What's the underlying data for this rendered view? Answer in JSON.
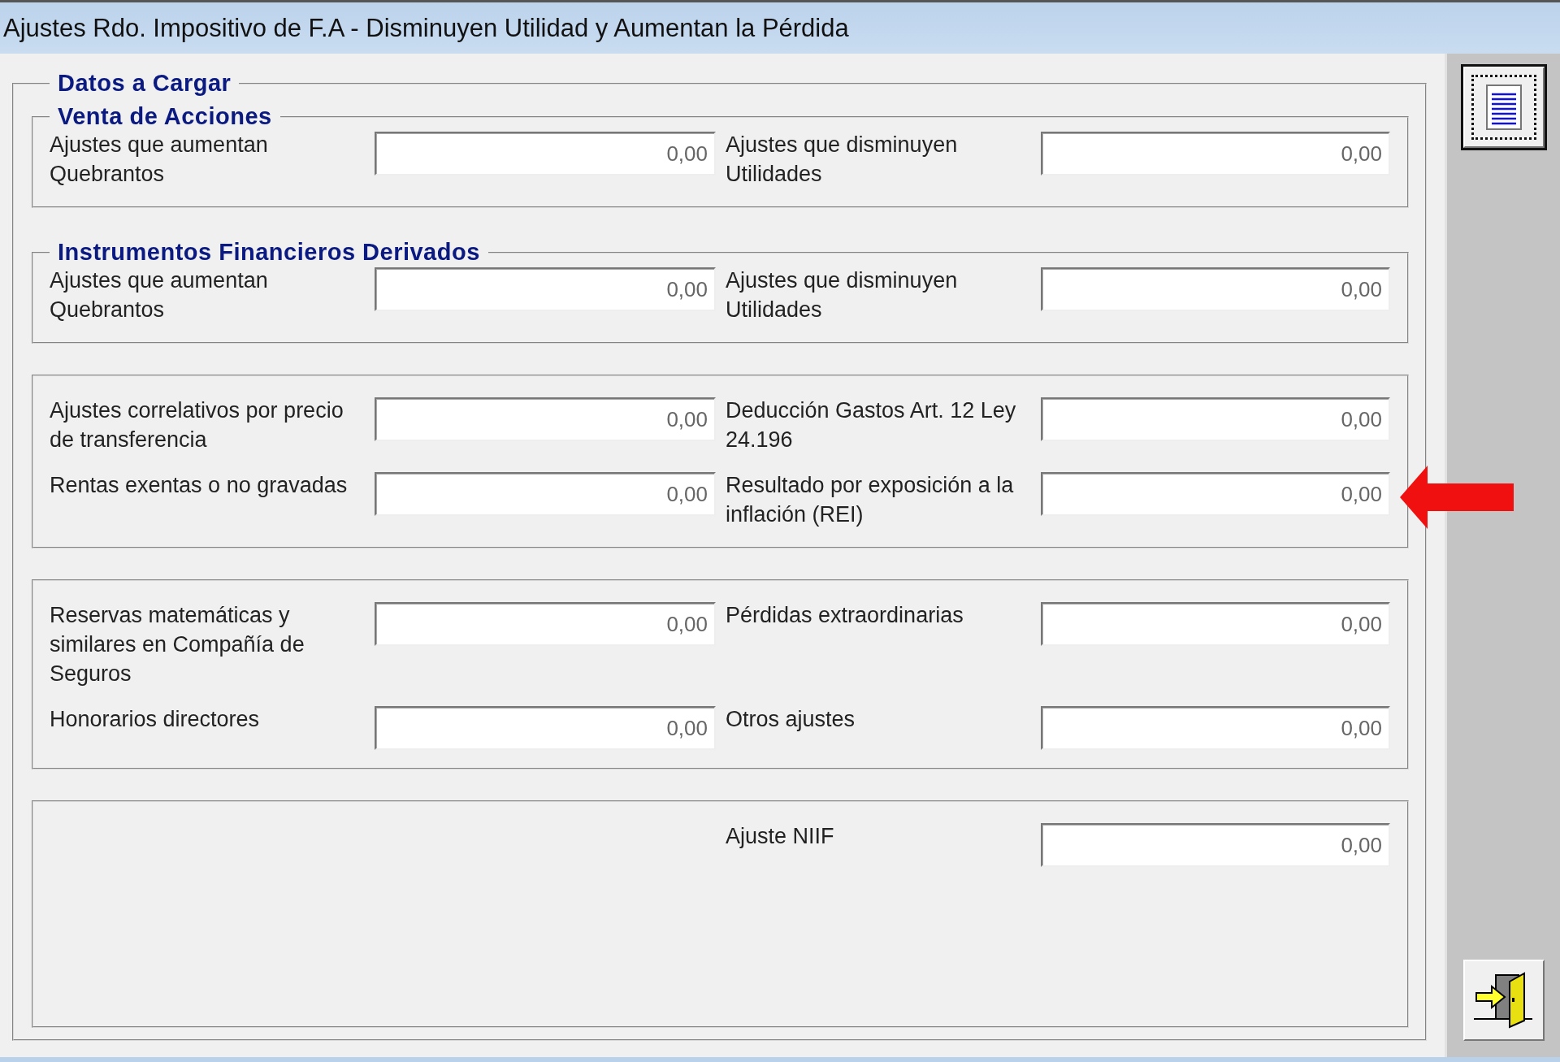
{
  "window": {
    "title": "Ajustes Rdo. Impositivo de F.A - Disminuyen Utilidad y Aumentan la Pérdida"
  },
  "form": {
    "legend": "Datos a Cargar",
    "groups": [
      {
        "legend": "Venta de Acciones",
        "rows": [
          {
            "left": {
              "label": "Ajustes que aumentan Quebrantos",
              "value": "0,00"
            },
            "right": {
              "label": "Ajustes que disminuyen Utilidades",
              "value": "0,00"
            }
          }
        ]
      },
      {
        "legend": "Instrumentos Financieros Derivados",
        "rows": [
          {
            "left": {
              "label": "Ajustes que aumentan Quebrantos",
              "value": "0,00"
            },
            "right": {
              "label": "Ajustes que disminuyen Utilidades",
              "value": "0,00"
            }
          }
        ]
      },
      {
        "rows": [
          {
            "left": {
              "label": "Ajustes correlativos por precio de transferencia",
              "value": "0,00"
            },
            "right": {
              "label": "Deducción Gastos Art. 12 Ley 24.196",
              "value": "0,00"
            }
          },
          {
            "left": {
              "label": "Rentas exentas o no gravadas",
              "value": "0,00"
            },
            "right": {
              "label": "Resultado por exposición a la inflación (REI)",
              "value": "0,00",
              "highlighted": true
            }
          }
        ]
      },
      {
        "rows": [
          {
            "left": {
              "label": "Reservas matemáticas y similares en Compañía de Seguros",
              "value": "0,00"
            },
            "right": {
              "label": "Pérdidas extraordinarias",
              "value": "0,00"
            }
          },
          {
            "left": {
              "label": "Honorarios directores",
              "value": "0,00"
            },
            "right": {
              "label": "Otros ajustes",
              "value": "0,00"
            }
          }
        ]
      },
      {
        "rows": [
          {
            "right": {
              "label": "Ajuste NIIF",
              "value": "0,00"
            }
          }
        ]
      }
    ]
  },
  "sidebar": {
    "buttons": [
      {
        "kind": "report",
        "focused": true
      },
      {
        "kind": "exit",
        "focused": false
      }
    ]
  }
}
